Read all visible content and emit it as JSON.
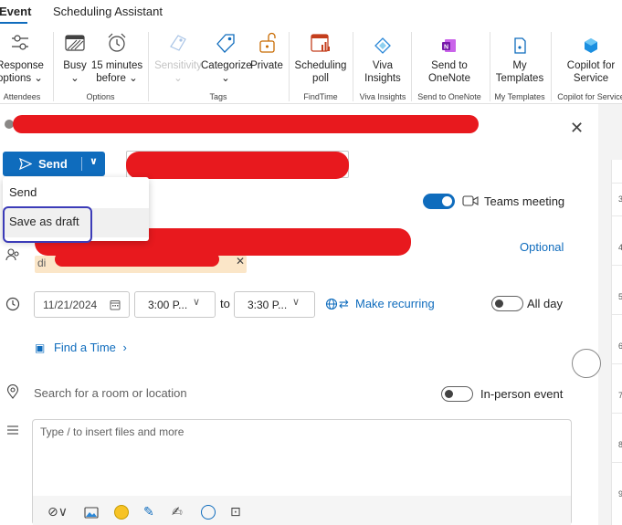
{
  "tabs": {
    "event": "Event",
    "scheduling": "Scheduling Assistant"
  },
  "ribbon": {
    "response_options": [
      "Response",
      "options ⌄"
    ],
    "busy": [
      "Busy",
      "⌄"
    ],
    "reminder": [
      "15 minutes",
      "before ⌄"
    ],
    "sensitivity": [
      "Sensitivity",
      "⌄"
    ],
    "categorize": [
      "Categorize",
      "⌄"
    ],
    "private": "Private",
    "scheduling_poll": [
      "Scheduling",
      "poll"
    ],
    "viva_insights": [
      "Viva",
      "Insights"
    ],
    "send_onenote": [
      "Send to",
      "OneNote"
    ],
    "my_templates": [
      "My",
      "Templates"
    ],
    "copilot_service": [
      "Copilot for",
      "Service"
    ],
    "groups": {
      "attendees": "Attendees",
      "options": "Options",
      "tags": "Tags",
      "findtime": "FindTime",
      "viva": "Viva Insights",
      "onenote": "Send to OneNote",
      "templates": "My Templates",
      "copilot": "Copilot for Service"
    }
  },
  "compose": {
    "send_label": "Send",
    "dropdown": {
      "send": "Send",
      "save_draft": "Save as draft"
    },
    "teams_meeting": "Teams meeting",
    "optional": "Optional",
    "attendee_fragment": "di",
    "date": "11/21/2024",
    "start_time": "3:00 P...",
    "to": "to",
    "end_time": "3:30 P...",
    "make_recurring": "Make recurring",
    "all_day": "All day",
    "find_time": "Find a Time",
    "location_placeholder": "Search for a room or location",
    "in_person": "In-person event",
    "body_placeholder": "Type / to insert files and more"
  },
  "calendar_hours": [
    "3",
    "4",
    "5",
    "6",
    "7",
    "8",
    "9"
  ],
  "colors": {
    "accent": "#0f6cbd",
    "redaction": "#e8191e"
  }
}
